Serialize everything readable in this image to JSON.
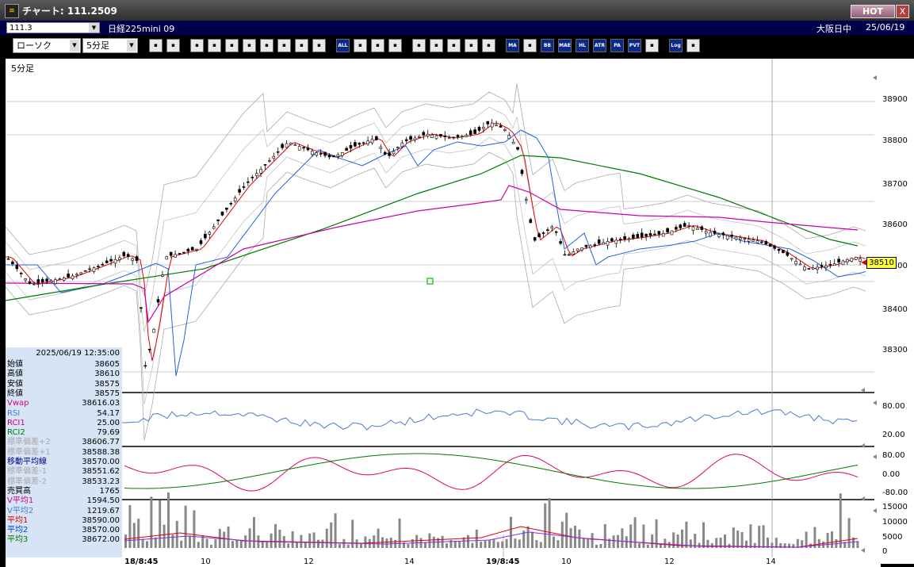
{
  "window": {
    "title": "チャート: 111.2509",
    "hot": "HOT",
    "close": "X",
    "icon": "≋"
  },
  "symbol_bar": {
    "symbol": "111.3",
    "contract": "日経225mini 09",
    "session": "大阪日中",
    "date": "25/06/19"
  },
  "toolbar": {
    "chart_type": "ローソク",
    "interval": "5分足",
    "labels": {
      "all": "ALL",
      "ma": "MA",
      "bb": "BB",
      "mae": "MAE",
      "hl": "HL",
      "atr": "ATR",
      "pvt": "PVT",
      "log": "Log",
      "pa": "PA"
    },
    "icon_names": [
      "zoom-icon",
      "window-icon",
      "pen-icon",
      "line-icon",
      "cursor-icon",
      "arrow-icon",
      "list-icon",
      "trash-icon",
      "candle-left-icon",
      "candle-right-icon",
      "all-button",
      "settings-icon",
      "wrench-icon",
      "palette-icon",
      "order-icon",
      "search-chart-icon",
      "compare-icon",
      "crosshair-icon",
      "pad-icon",
      "ma-button",
      "mr-icon",
      "bb-button",
      "mae-button",
      "hl-button",
      "atr-button",
      "pa-button",
      "pvt-button",
      "square-icon",
      "log-button",
      "exit-icon"
    ]
  },
  "chart": {
    "timeframe_label": "5分足",
    "current_price": "38510",
    "price_ticks": [
      "38900",
      "38800",
      "38700",
      "38600",
      "38500",
      "38400",
      "38300"
    ],
    "rsi_ticks": [
      "80.00",
      "20.00"
    ],
    "rci_ticks": [
      "80.00",
      "0.00",
      "-80.00"
    ],
    "volume_ticks": [
      "15000",
      "10000",
      "5000",
      "0"
    ],
    "time_labels": [
      "18/8:45",
      "10",
      "12",
      "14",
      "19/8:45",
      "10",
      "12",
      "14"
    ]
  },
  "info_panel": {
    "datetime": "2025/06/19  12:35:00",
    "rows": [
      {
        "label": "始値",
        "value": "38605",
        "color": "#000"
      },
      {
        "label": "高値",
        "value": "38610",
        "color": "#000"
      },
      {
        "label": "安値",
        "value": "38575",
        "color": "#000"
      },
      {
        "label": "終値",
        "value": "38575",
        "color": "#000"
      },
      {
        "label": "Vwap",
        "value": "38616.03",
        "color": "#d4007a"
      },
      {
        "label": "RSI",
        "value": "54.17",
        "color": "#4f7ad0"
      },
      {
        "label": "RCI1",
        "value": "25.00",
        "color": "#d4007a"
      },
      {
        "label": "RCI2",
        "value": "79.69",
        "color": "#007a00"
      },
      {
        "label": "標準偏差+2",
        "value": "38606.77",
        "color": "#aaaaaa"
      },
      {
        "label": "標準偏差+1",
        "value": "38588.38",
        "color": "#aaaaaa"
      },
      {
        "label": "移動平均線",
        "value": "38570.00",
        "color": "#00008b"
      },
      {
        "label": "標準偏差-1",
        "value": "38551.62",
        "color": "#aaaaaa"
      },
      {
        "label": "標準偏差-2",
        "value": "38533.23",
        "color": "#aaaaaa"
      },
      {
        "label": "売買高",
        "value": "1765",
        "color": "#000"
      },
      {
        "label": "V平均1",
        "value": "1594.50",
        "color": "#d4007a"
      },
      {
        "label": "V平均2",
        "value": "1219.67",
        "color": "#4f7ad0"
      },
      {
        "label": "平均1",
        "value": "38590.00",
        "color": "#e00000"
      },
      {
        "label": "平均2",
        "value": "38570.00",
        "color": "#0040d0"
      },
      {
        "label": "平均3",
        "value": "38672.00",
        "color": "#007a00"
      }
    ]
  }
}
